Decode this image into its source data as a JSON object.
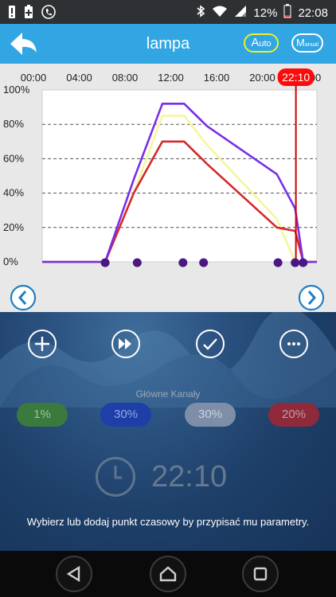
{
  "status": {
    "battery_percent": "12%",
    "time": "22:08",
    "icons": [
      "alert-icon",
      "battery-saver-icon",
      "phone-app-icon",
      "bluetooth-icon",
      "wifi-icon",
      "signal-icon",
      "battery-icon"
    ]
  },
  "header": {
    "title": "lampa",
    "auto_letter": "A",
    "auto_rest": "uto",
    "manual_letter": "M",
    "manual_rest": "anual"
  },
  "chart_data": {
    "type": "line",
    "x_ticks": [
      "00:00",
      "04:00",
      "08:00",
      "12:00",
      "16:00",
      "20:00",
      "24:00"
    ],
    "y_ticks": [
      "100%",
      "80%",
      "60%",
      "40%",
      "20%",
      "0%"
    ],
    "xlim": [
      0,
      24
    ],
    "ylim": [
      0,
      100
    ],
    "current_time_label": "22:10",
    "current_time_value": 22.1667,
    "series": [
      {
        "color": "#f7f59a",
        "points": [
          [
            0,
            0
          ],
          [
            5.5,
            0
          ],
          [
            8,
            40
          ],
          [
            10.5,
            85
          ],
          [
            12.4,
            85
          ],
          [
            14.4,
            68
          ],
          [
            20.5,
            25
          ],
          [
            22.1,
            0
          ],
          [
            24,
            0
          ]
        ]
      },
      {
        "color": "#d32a2a",
        "points": [
          [
            0,
            0
          ],
          [
            5.5,
            0
          ],
          [
            8,
            40
          ],
          [
            10.5,
            70
          ],
          [
            12.4,
            70
          ],
          [
            14.4,
            57
          ],
          [
            20.5,
            20
          ],
          [
            22.1,
            18
          ],
          [
            22.8,
            0
          ],
          [
            24,
            0
          ]
        ]
      },
      {
        "color": "#7a2ee8",
        "points": [
          [
            0,
            0
          ],
          [
            5.5,
            0
          ],
          [
            8,
            48
          ],
          [
            10.5,
            92
          ],
          [
            12.4,
            92
          ],
          [
            14.4,
            79
          ],
          [
            20.5,
            51
          ],
          [
            22.1,
            31
          ],
          [
            22.8,
            0
          ],
          [
            24,
            0
          ]
        ]
      }
    ],
    "timepoints": [
      5.5,
      8.3,
      12.3,
      14.1,
      20.6,
      22.1,
      22.8
    ]
  },
  "actions": {
    "icons": [
      "add-icon",
      "fast-forward-icon",
      "check-icon",
      "more-icon"
    ]
  },
  "channels": {
    "title": "Główne Kanały",
    "items": [
      {
        "value": "1%",
        "bg": "#3b7a3e",
        "fg": "#9fc49a"
      },
      {
        "value": "30%",
        "bg": "#1e3fa8",
        "fg": "#8fa8e8"
      },
      {
        "value": "30%",
        "bg": "#7f8ea8",
        "fg": "#c9d2e0"
      },
      {
        "value": "20%",
        "bg": "#8e2a3a",
        "fg": "#c99aa3"
      }
    ]
  },
  "clock": {
    "time": "22:10"
  },
  "hint": "Wybierz lub dodaj punkt czasowy by przypisać mu parametry."
}
